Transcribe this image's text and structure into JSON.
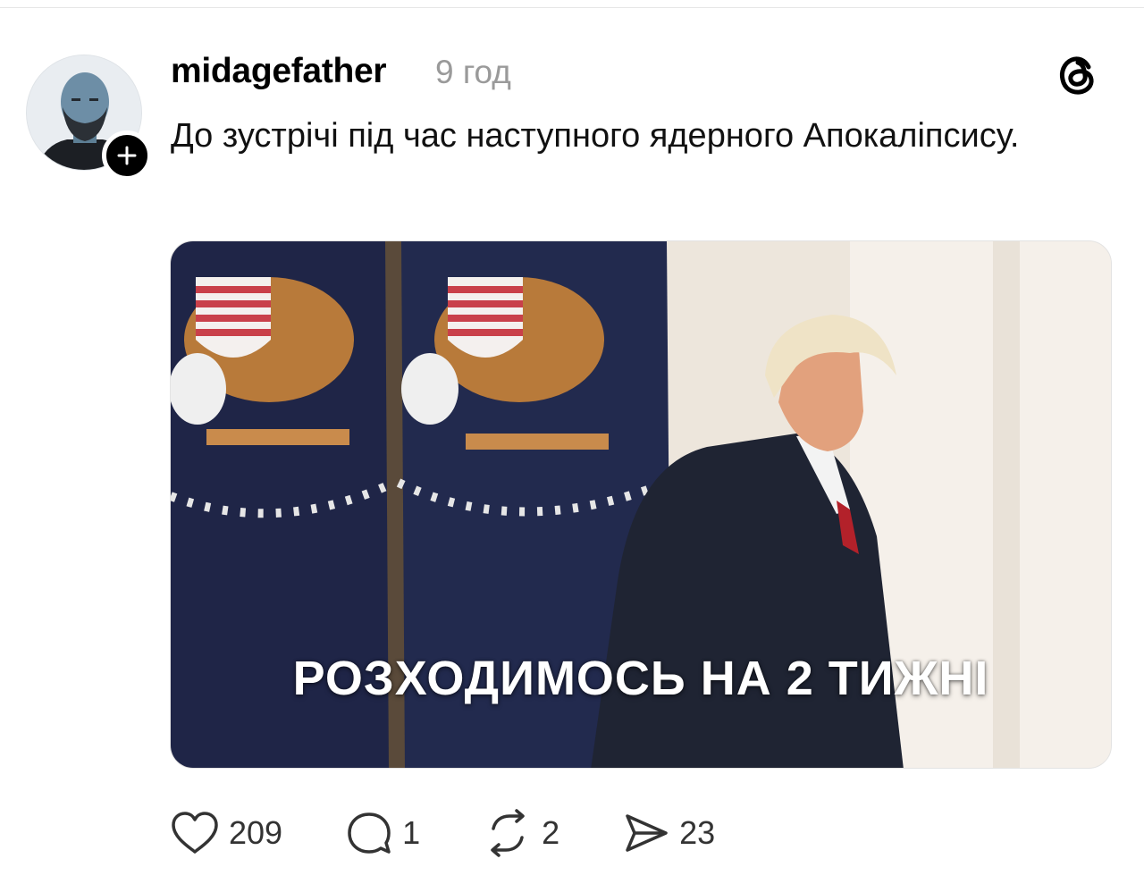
{
  "post": {
    "username": "midagefather",
    "time": "9 год",
    "text": "До зустрічі під час наступного ядерного Апокаліпсису.",
    "media_caption": "РОЗХОДИМОСЬ НА 2 ТИЖНІ"
  },
  "actions": {
    "likes": "209",
    "replies": "1",
    "reposts": "2",
    "shares": "23"
  },
  "icons": [
    "avatar",
    "plus-icon",
    "threads-logo-icon",
    "heart-icon",
    "comment-icon",
    "repost-icon",
    "share-icon"
  ]
}
